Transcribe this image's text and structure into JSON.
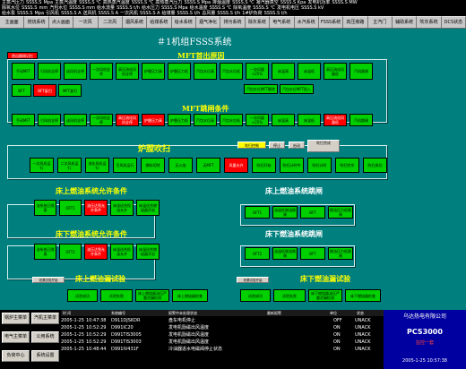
{
  "top": {
    "row1": [
      "主蒸汽压力",
      "SSSS.S",
      "Mpa",
      "主蒸汽温度",
      "SSSS.S ℃",
      "高热蒸汽温度",
      "SSSS.S ℃",
      "高热蒸汽压力",
      "SSSS.S Mpa",
      "排烟温度",
      "SSSS.S ℃",
      "凝汽器真空",
      "SSSS.S Kpa",
      "发电机功率",
      "SSSS.S MW"
    ],
    "row2": [
      "除氧水位",
      "SSSS.S",
      "mm",
      "汽包水位",
      "SSSS.S mm",
      "给水流量",
      "SSSS.S t/h",
      "给水压力",
      "SSSS.S Mpa",
      "给水温度",
      "SSSS.S ℃",
      "除氧温度",
      "SSSS.S ℃",
      "发电机电压",
      "SSSS.S kV"
    ],
    "row3": [
      "给水泵",
      "SSSS.S",
      "Mpa",
      "引风机",
      "SSSS.S A",
      "送风机",
      "SSSS.S A",
      "一次风机",
      "SSSS.S A",
      "给煤量",
      "SSSS.S t/h",
      "总风量",
      "SSSS.S t/h",
      "1#炉负荷",
      "SSSS.S t/h"
    ]
  },
  "nav": [
    "主画面",
    "燃烧系统",
    "点火画面",
    "一次风",
    "二次风",
    "烟风系统",
    "给煤系统",
    "给水系统",
    "烟气净化",
    "排污系统",
    "除灰系统",
    "电气系统",
    "水汽系统",
    "FSSS系统",
    "高压旁路",
    "主汽门",
    "辅助系统",
    "吹灰系统",
    "DCS状态"
  ],
  "main": {
    "title": "＃1机组FSSS系统",
    "mft_btn": "首出跳闸记忆",
    "mft_title": "MFT首出原因",
    "mft_row": [
      "手动MFT",
      "引风机全停",
      "送风机全停",
      "一次风机全停",
      "高压流化风机全停",
      "炉膛压力高",
      "炉膛压力低",
      "汽包水位高",
      "汽包水位低",
      "一次风量<25%",
      "床温高",
      "床温低",
      "高压流化风量低",
      "汽机跳闸"
    ],
    "mft_row2": [
      "BFT",
      "BFT复归",
      "MFT复归",
      "汽包水位MFT解除",
      "汽包水位MFT投入"
    ],
    "trip_title": "MFT跳闸条件",
    "trip_row": [
      "手动MFT",
      "引风机全停",
      "送风机全停",
      "一次风机全停",
      "高压流化风机全停",
      "炉膛压力高",
      "炉膛压力低",
      "汽包水位高",
      "汽包水位低",
      "一次风量<25%",
      "床温高",
      "床温低",
      "高压流化风量低",
      "汽机跳闸"
    ],
    "purge_title": "炉膛吹扫",
    "purge_btns": [
      "吹扫控制",
      "停止",
      "启动",
      "吹扫完成"
    ],
    "purge_done": "吹扫完成",
    "purge_row": [
      "一次风机运行",
      "二次风机运行",
      "流化风机运行",
      "引风机运行",
      "燃料切除",
      "无火焰",
      "无MFT",
      "风量允许",
      "吹扫开始",
      "吹扫计时中",
      "吹扫计时",
      "吹扫完毕",
      "吹扫成功"
    ],
    "s1": "床上燃油系统允许条件",
    "s1_items": [
      "油系统已隔离",
      "OFT1",
      "油压达到允许条件",
      "床温适合投油允许",
      "床温适合燃烧器开启"
    ],
    "s2": "床上燃油系统跳闸",
    "s2_items": [
      "OFT1",
      "油温低燃油跳闸",
      "BFT",
      "燃油压力低跳闸"
    ],
    "s3": "床下燃油系统允许条件",
    "s3_items": [
      "油系统已隔离",
      "OFT2",
      "油压达到允许条件",
      "床温适合投油允许",
      "床温适合燃烧器开启"
    ],
    "s4": "床下燃油系统跳闸",
    "s4_items": [
      "OFT2",
      "油温低燃油跳闸",
      "BFT",
      "燃油压力低跳闸"
    ],
    "s5": "床上燃油漏试验",
    "s5_items": [
      "试验成功",
      "试验失败",
      "床上燃烧器油压严重泄漏检测",
      "床上燃烧器检查"
    ],
    "s5_tag": "泄漏试验开始",
    "s6": "床下燃油漏试验",
    "s6_items": [
      "试验成功",
      "试验失败",
      "床下燃烧器油压严重泄漏检测",
      "床下燃烧器检查"
    ],
    "s6_tag": "泄漏试验开始"
  },
  "bottom": {
    "left_btns": [
      "锅炉主菜单",
      "汽机主菜单",
      "电气主菜单",
      "公用系统",
      "负荷中心",
      "系统设置"
    ],
    "headers": [
      "时  间",
      "系统编号",
      "报警中未处理状态",
      "最新报警",
      "单位",
      "状态"
    ],
    "alarms": [
      [
        "2005-1-25",
        "10:47:38",
        "D911DJSKDR",
        "盘车电机停止",
        "",
        "OFF",
        "UNACK"
      ],
      [
        "2005-1-25",
        "10:52:29",
        "D991IC20",
        "发电机励磁出风温度",
        "",
        "ON",
        "UNACK"
      ],
      [
        "2005-1-25",
        "10:52:29",
        "D991TIS3005",
        "发电机励磁出风温度",
        "",
        "ON",
        "UNACK"
      ],
      [
        "2005-1-25",
        "10:52:29",
        "D991TIS3003",
        "发电机励磁出风温度",
        "",
        "ON",
        "UNACK"
      ],
      [
        "2005-1-25",
        "10:48:44",
        "D991IV431F",
        "冷油器进水电磁阀停止状态",
        "",
        "ON",
        "UNACK"
      ]
    ],
    "company": "乌达热电有限公司",
    "product": "PCS3000",
    "version": "监控一套",
    "datetime": "2005-1-25    10:57:38"
  }
}
